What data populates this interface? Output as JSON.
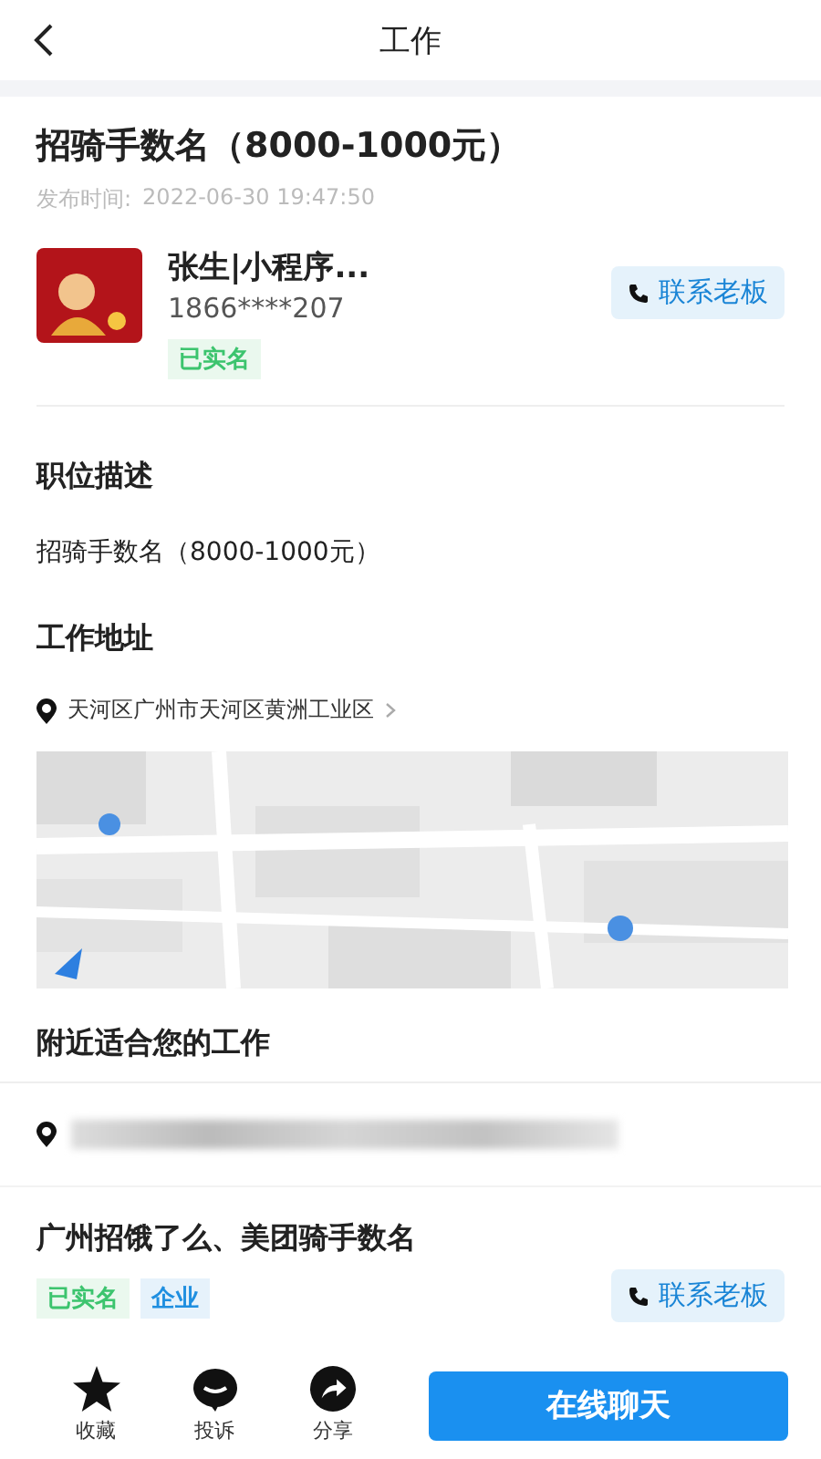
{
  "header": {
    "title": "工作"
  },
  "job": {
    "title": "招骑手数名（8000-1000元）",
    "posted_label": "发布时间:",
    "posted_time": "2022-06-30 19:47:50"
  },
  "publisher": {
    "name": "张生|小程序...",
    "phone": "1866****207",
    "badges": [
      {
        "text": "已实名",
        "kind": "verified"
      }
    ],
    "contact_button": "联系老板"
  },
  "description": {
    "heading": "职位描述",
    "text": "招骑手数名（8000-1000元）"
  },
  "address": {
    "heading": "工作地址",
    "text": "天河区广州市天河区黄洲工业区"
  },
  "nearby": {
    "heading": "附近适合您的工作",
    "items": [
      {
        "title": "广州招饿了么、美团骑手数名",
        "badges": [
          {
            "text": "已实名",
            "kind": "verified"
          },
          {
            "text": "企业",
            "kind": "company"
          }
        ],
        "contact_button": "联系老板"
      }
    ]
  },
  "bottom_bar": {
    "actions": [
      {
        "label": "收藏",
        "kind": "star"
      },
      {
        "label": "投诉",
        "kind": "complain"
      },
      {
        "label": "分享",
        "kind": "share"
      }
    ],
    "chat_button": "在线聊天"
  }
}
